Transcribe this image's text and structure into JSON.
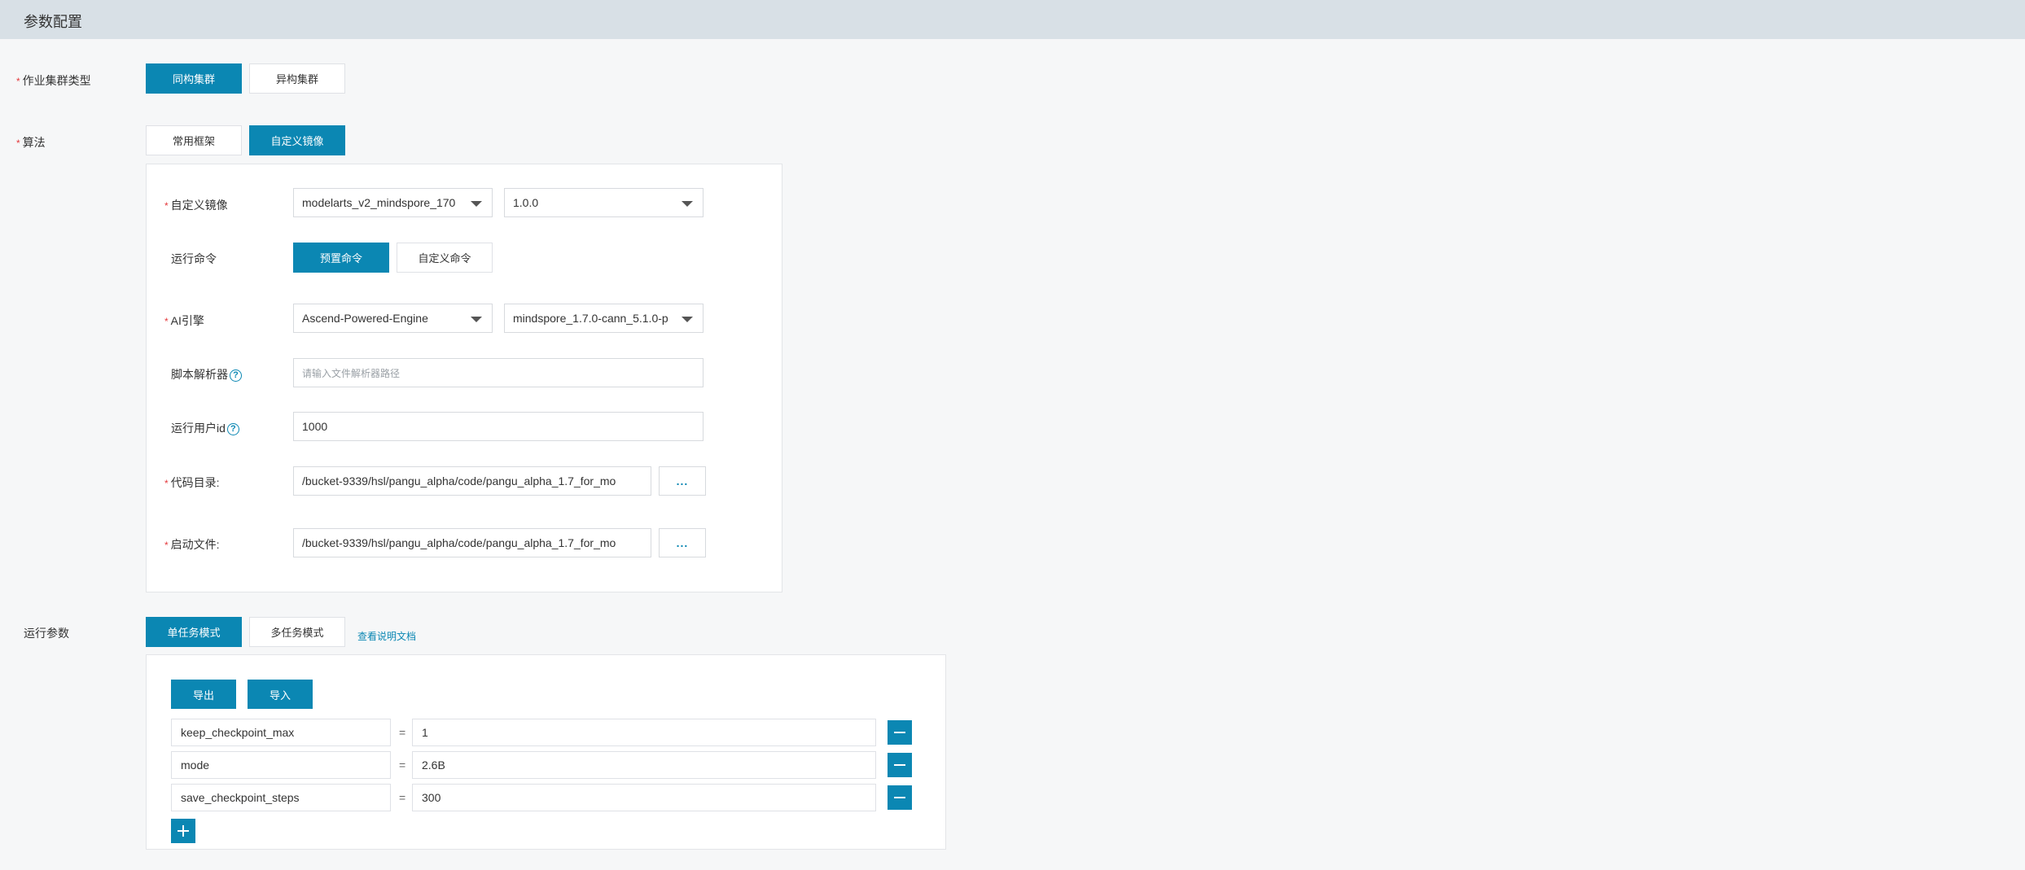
{
  "header": {
    "title": "参数配置"
  },
  "cluster_type": {
    "label": "作业集群类型",
    "options": [
      "同构集群",
      "异构集群"
    ],
    "selected": 0
  },
  "algorithm": {
    "label": "算法",
    "tabs": [
      "常用框架",
      "自定义镜像"
    ],
    "selected": 1,
    "custom_image": {
      "label": "自定义镜像",
      "image_value": "modelarts_v2_mindspore_170",
      "version_value": "1.0.0"
    },
    "run_command": {
      "label": "运行命令",
      "options": [
        "预置命令",
        "自定义命令"
      ],
      "selected": 0
    },
    "ai_engine": {
      "label": "AI引擎",
      "engine_value": "Ascend-Powered-Engine",
      "version_value": "mindspore_1.7.0-cann_5.1.0-p"
    },
    "script_interpreter": {
      "label": "脚本解析器",
      "placeholder": "请输入文件解析器路径",
      "value": ""
    },
    "run_user_id": {
      "label": "运行用户id",
      "value": "1000"
    },
    "code_dir": {
      "label": "代码目录:",
      "value": "/bucket-9339/hsl/pangu_alpha/code/pangu_alpha_1.7_for_mo",
      "browse": "..."
    },
    "boot_file": {
      "label": "启动文件:",
      "value": "/bucket-9339/hsl/pangu_alpha/code/pangu_alpha_1.7_for_mo",
      "browse": "..."
    }
  },
  "run_params": {
    "label": "运行参数",
    "modes": [
      "单任务模式",
      "多任务模式"
    ],
    "selected": 0,
    "doc_link": "查看说明文档",
    "export_label": "导出",
    "import_label": "导入",
    "equals": "=",
    "items": [
      {
        "key": "keep_checkpoint_max",
        "value": "1"
      },
      {
        "key": "mode",
        "value": "2.6B"
      },
      {
        "key": "save_checkpoint_steps",
        "value": "300"
      }
    ],
    "add_icon": "plus-icon",
    "remove_icon": "minus-icon"
  },
  "colors": {
    "accent": "#0b87b3",
    "required": "#e4393c",
    "header_bg": "#d8e0e6"
  }
}
